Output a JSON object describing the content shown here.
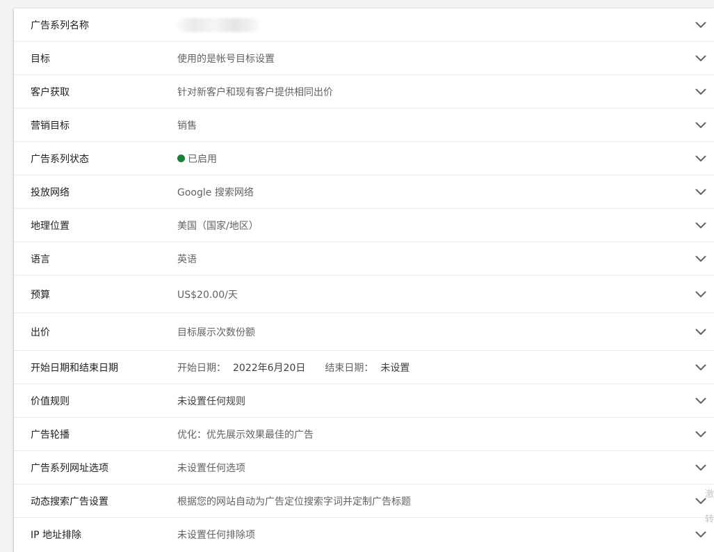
{
  "rows": [
    {
      "label": "广告系列名称",
      "value": ""
    },
    {
      "label": "目标",
      "value": "使用的是帐号目标设置"
    },
    {
      "label": "客户获取",
      "value": "针对新客户和现有客户提供相同出价"
    },
    {
      "label": "营销目标",
      "value": "销售"
    },
    {
      "label": "广告系列状态",
      "value": "已启用"
    },
    {
      "label": "投放网络",
      "value": "Google 搜索网络"
    },
    {
      "label": "地理位置",
      "value": "美国（国家/地区）"
    },
    {
      "label": "语言",
      "value": "英语"
    },
    {
      "label": "预算",
      "value": "US$20.00/天"
    },
    {
      "label": "出价",
      "value": "目标展示次数份额"
    },
    {
      "label": "开始日期和结束日期",
      "start_label": "开始日期：",
      "start_value": "2022年6月20日",
      "end_label": "结束日期：",
      "end_value": "未设置"
    },
    {
      "label": "价值规则",
      "value": "未设置任何规则"
    },
    {
      "label": "广告轮播",
      "value": "优化：优先展示效果最佳的广告"
    },
    {
      "label": "广告系列网址选项",
      "value": "未设置任何选项"
    },
    {
      "label": "动态搜索广告设置",
      "value": "根据您的网站自动为广告定位搜索字词并定制广告标题"
    },
    {
      "label": "IP 地址排除",
      "value": "未设置任何排除项"
    }
  ],
  "status_color": "#188038",
  "icons": {
    "expand": "chevron-down-icon",
    "status": "status-dot-icon"
  },
  "edge_overlay": {
    "line1": "激",
    "line2": "转"
  }
}
